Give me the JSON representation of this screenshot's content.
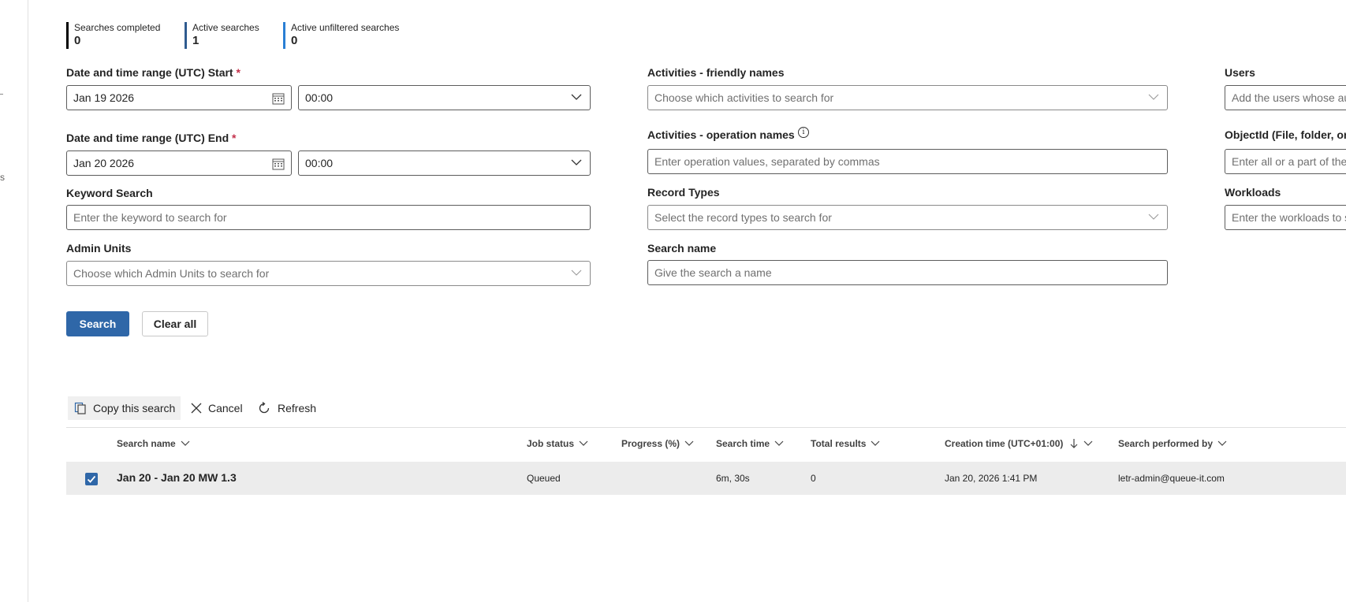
{
  "stats": [
    {
      "label": "Searches completed",
      "value": "0",
      "color": "#000000"
    },
    {
      "label": "Active searches",
      "value": "1",
      "color": "#2f5b8f"
    },
    {
      "label": "Active unfiltered searches",
      "value": "0",
      "color": "#2a7fd4"
    }
  ],
  "form": {
    "start_label": "Date and time range (UTC) Start",
    "start_date": "Jan 19 2026",
    "start_time": "00:00",
    "end_label": "Date and time range (UTC) End",
    "end_date": "Jan 20 2026",
    "end_time": "00:00",
    "required_mark": "*",
    "keyword_label": "Keyword Search",
    "keyword_placeholder": "Enter the keyword to search for",
    "admin_units_label": "Admin Units",
    "admin_units_placeholder": "Choose which Admin Units to search for",
    "activities_friendly_label": "Activities - friendly names",
    "activities_friendly_placeholder": "Choose which activities to search for",
    "activities_operation_label": "Activities - operation names",
    "activities_operation_placeholder": "Enter operation values, separated by commas",
    "record_types_label": "Record Types",
    "record_types_placeholder": "Select the record types to search for",
    "search_name_label": "Search name",
    "search_name_placeholder": "Give the search a name",
    "users_label": "Users",
    "users_placeholder": "Add the users whose au",
    "objectid_label": "ObjectId (File, folder, or",
    "objectid_placeholder": "Enter all or a part of the",
    "workloads_label": "Workloads",
    "workloads_placeholder": "Enter the workloads to s"
  },
  "buttons": {
    "search": "Search",
    "clear_all": "Clear all"
  },
  "toolbar": {
    "copy": "Copy this search",
    "cancel": "Cancel",
    "refresh": "Refresh"
  },
  "table": {
    "columns": [
      "Search name",
      "Job status",
      "Progress (%)",
      "Search time",
      "Total results",
      "Creation time (UTC+01:00)",
      "Search performed by"
    ],
    "rows": [
      {
        "search_name": "Jan 20 - Jan 20 MW 1.3",
        "job_status": "Queued",
        "progress": "",
        "search_time": "6m, 30s",
        "total_results": "0",
        "creation_time": "Jan 20, 2026 1:41 PM",
        "performed_by": "letr-admin@queue-it.com",
        "selected": true
      }
    ]
  },
  "rail": {
    "fragment": "s"
  }
}
